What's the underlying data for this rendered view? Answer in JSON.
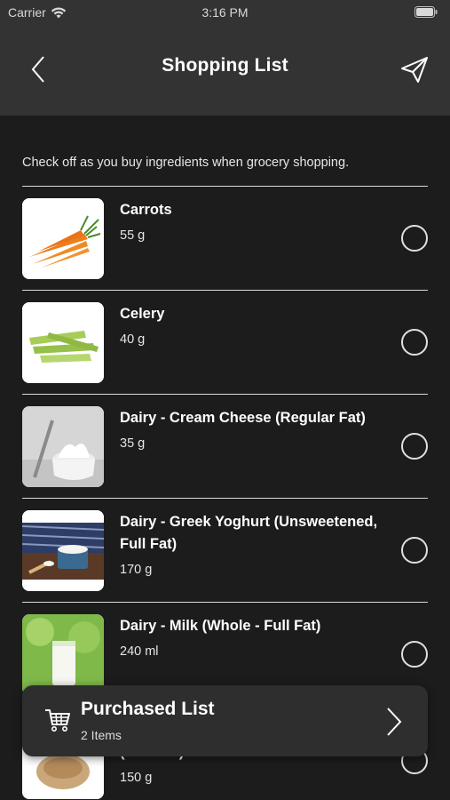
{
  "status": {
    "carrier": "Carrier",
    "time": "3:16 PM"
  },
  "header": {
    "title": "Shopping List"
  },
  "intro": "Check off as you buy ingredients when grocery shopping.",
  "items": [
    {
      "name": "Carrots",
      "qty": "55 g"
    },
    {
      "name": "Celery",
      "qty": "40 g"
    },
    {
      "name": "Dairy - Cream Cheese (Regular Fat)",
      "qty": "35 g"
    },
    {
      "name": "Dairy - Greek Yoghurt (Unsweetened, Full Fat)",
      "qty": "170 g"
    },
    {
      "name": "Dairy - Milk (Whole - Full Fat)",
      "qty": "240 ml"
    },
    {
      "name": "(Drained)",
      "qty": "150 g"
    }
  ],
  "purchased": {
    "title": "Purchased List",
    "count": "2 Items"
  }
}
